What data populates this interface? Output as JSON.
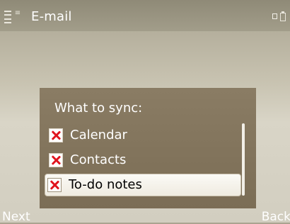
{
  "title_bar": {
    "title": "E-mail",
    "icons": [
      "signal-icon",
      "network-icon",
      "battery-icon"
    ]
  },
  "dialog": {
    "title": "What to sync:",
    "items": [
      {
        "label": "Calendar",
        "checked": true,
        "selected": false
      },
      {
        "label": "Contacts",
        "checked": true,
        "selected": false
      },
      {
        "label": "To-do notes",
        "checked": true,
        "selected": true
      }
    ]
  },
  "softkeys": {
    "left": "Next",
    "right": "Back"
  },
  "colors": {
    "dialog_bg": "#7b6d55",
    "check_mark": "#e0141e",
    "highlight": "#fbfaf6"
  }
}
